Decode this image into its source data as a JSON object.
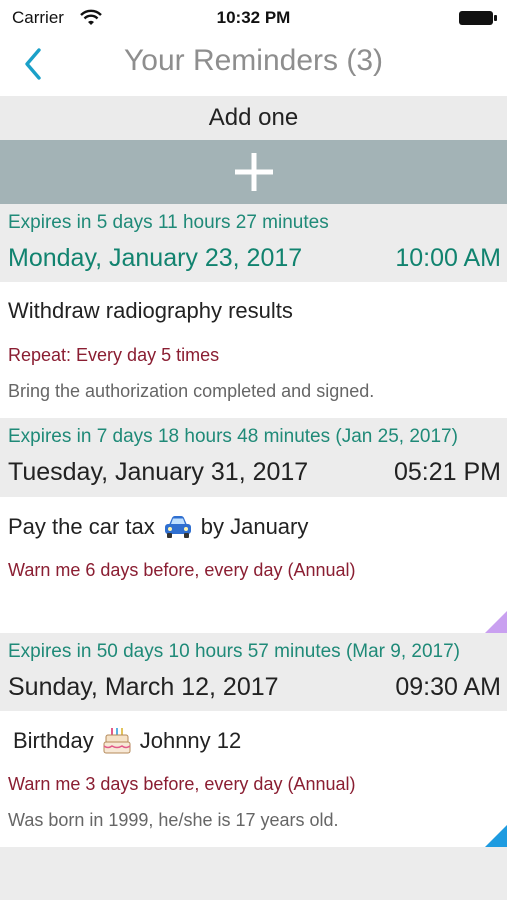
{
  "status_bar": {
    "carrier": "Carrier",
    "time": "10:32 PM"
  },
  "nav": {
    "back_icon": "chevron-left-icon",
    "title": "Your Reminders (3)"
  },
  "add": {
    "label": "Add one",
    "button_icon": "plus-icon"
  },
  "colors": {
    "accent_green": "#11836f",
    "expires_green": "#1f8a78",
    "repeat_red": "#8a1e32",
    "back_blue": "#1aa0c8",
    "add_bar": "#a3b3b6",
    "triangle_purple": "#c9a0f0",
    "triangle_blue": "#1e9be0"
  },
  "reminders": [
    {
      "expires": "Expires in 5 days  11 hours  27 minutes",
      "date": "Monday, January 23, 2017",
      "time": "10:00 AM",
      "title": "Withdraw radiography results",
      "repeat": "Repeat: Every day   5 times",
      "note": "Bring the authorization completed and signed."
    },
    {
      "expires": "Expires in 7 days  18 hours  48 minutes  (Jan 25, 2017)",
      "date": "Tuesday, January 31, 2017",
      "time": "05:21 PM",
      "title_before": "Pay the car tax",
      "title_icon": "car-icon",
      "title_after": "by January",
      "repeat": "Warn me 6 days before, every day (Annual)"
    },
    {
      "expires": "Expires in 50 days  10 hours  57 minutes  (Mar 9, 2017)",
      "date": "Sunday, March 12, 2017",
      "time": "09:30 AM",
      "title_before": "Birthday",
      "title_icon": "birthday-cake-icon",
      "title_after": "Johnny 12",
      "repeat": "Warn me 3 days before, every day (Annual)",
      "note": "Was born in 1999, he/she is 17 years old."
    }
  ]
}
